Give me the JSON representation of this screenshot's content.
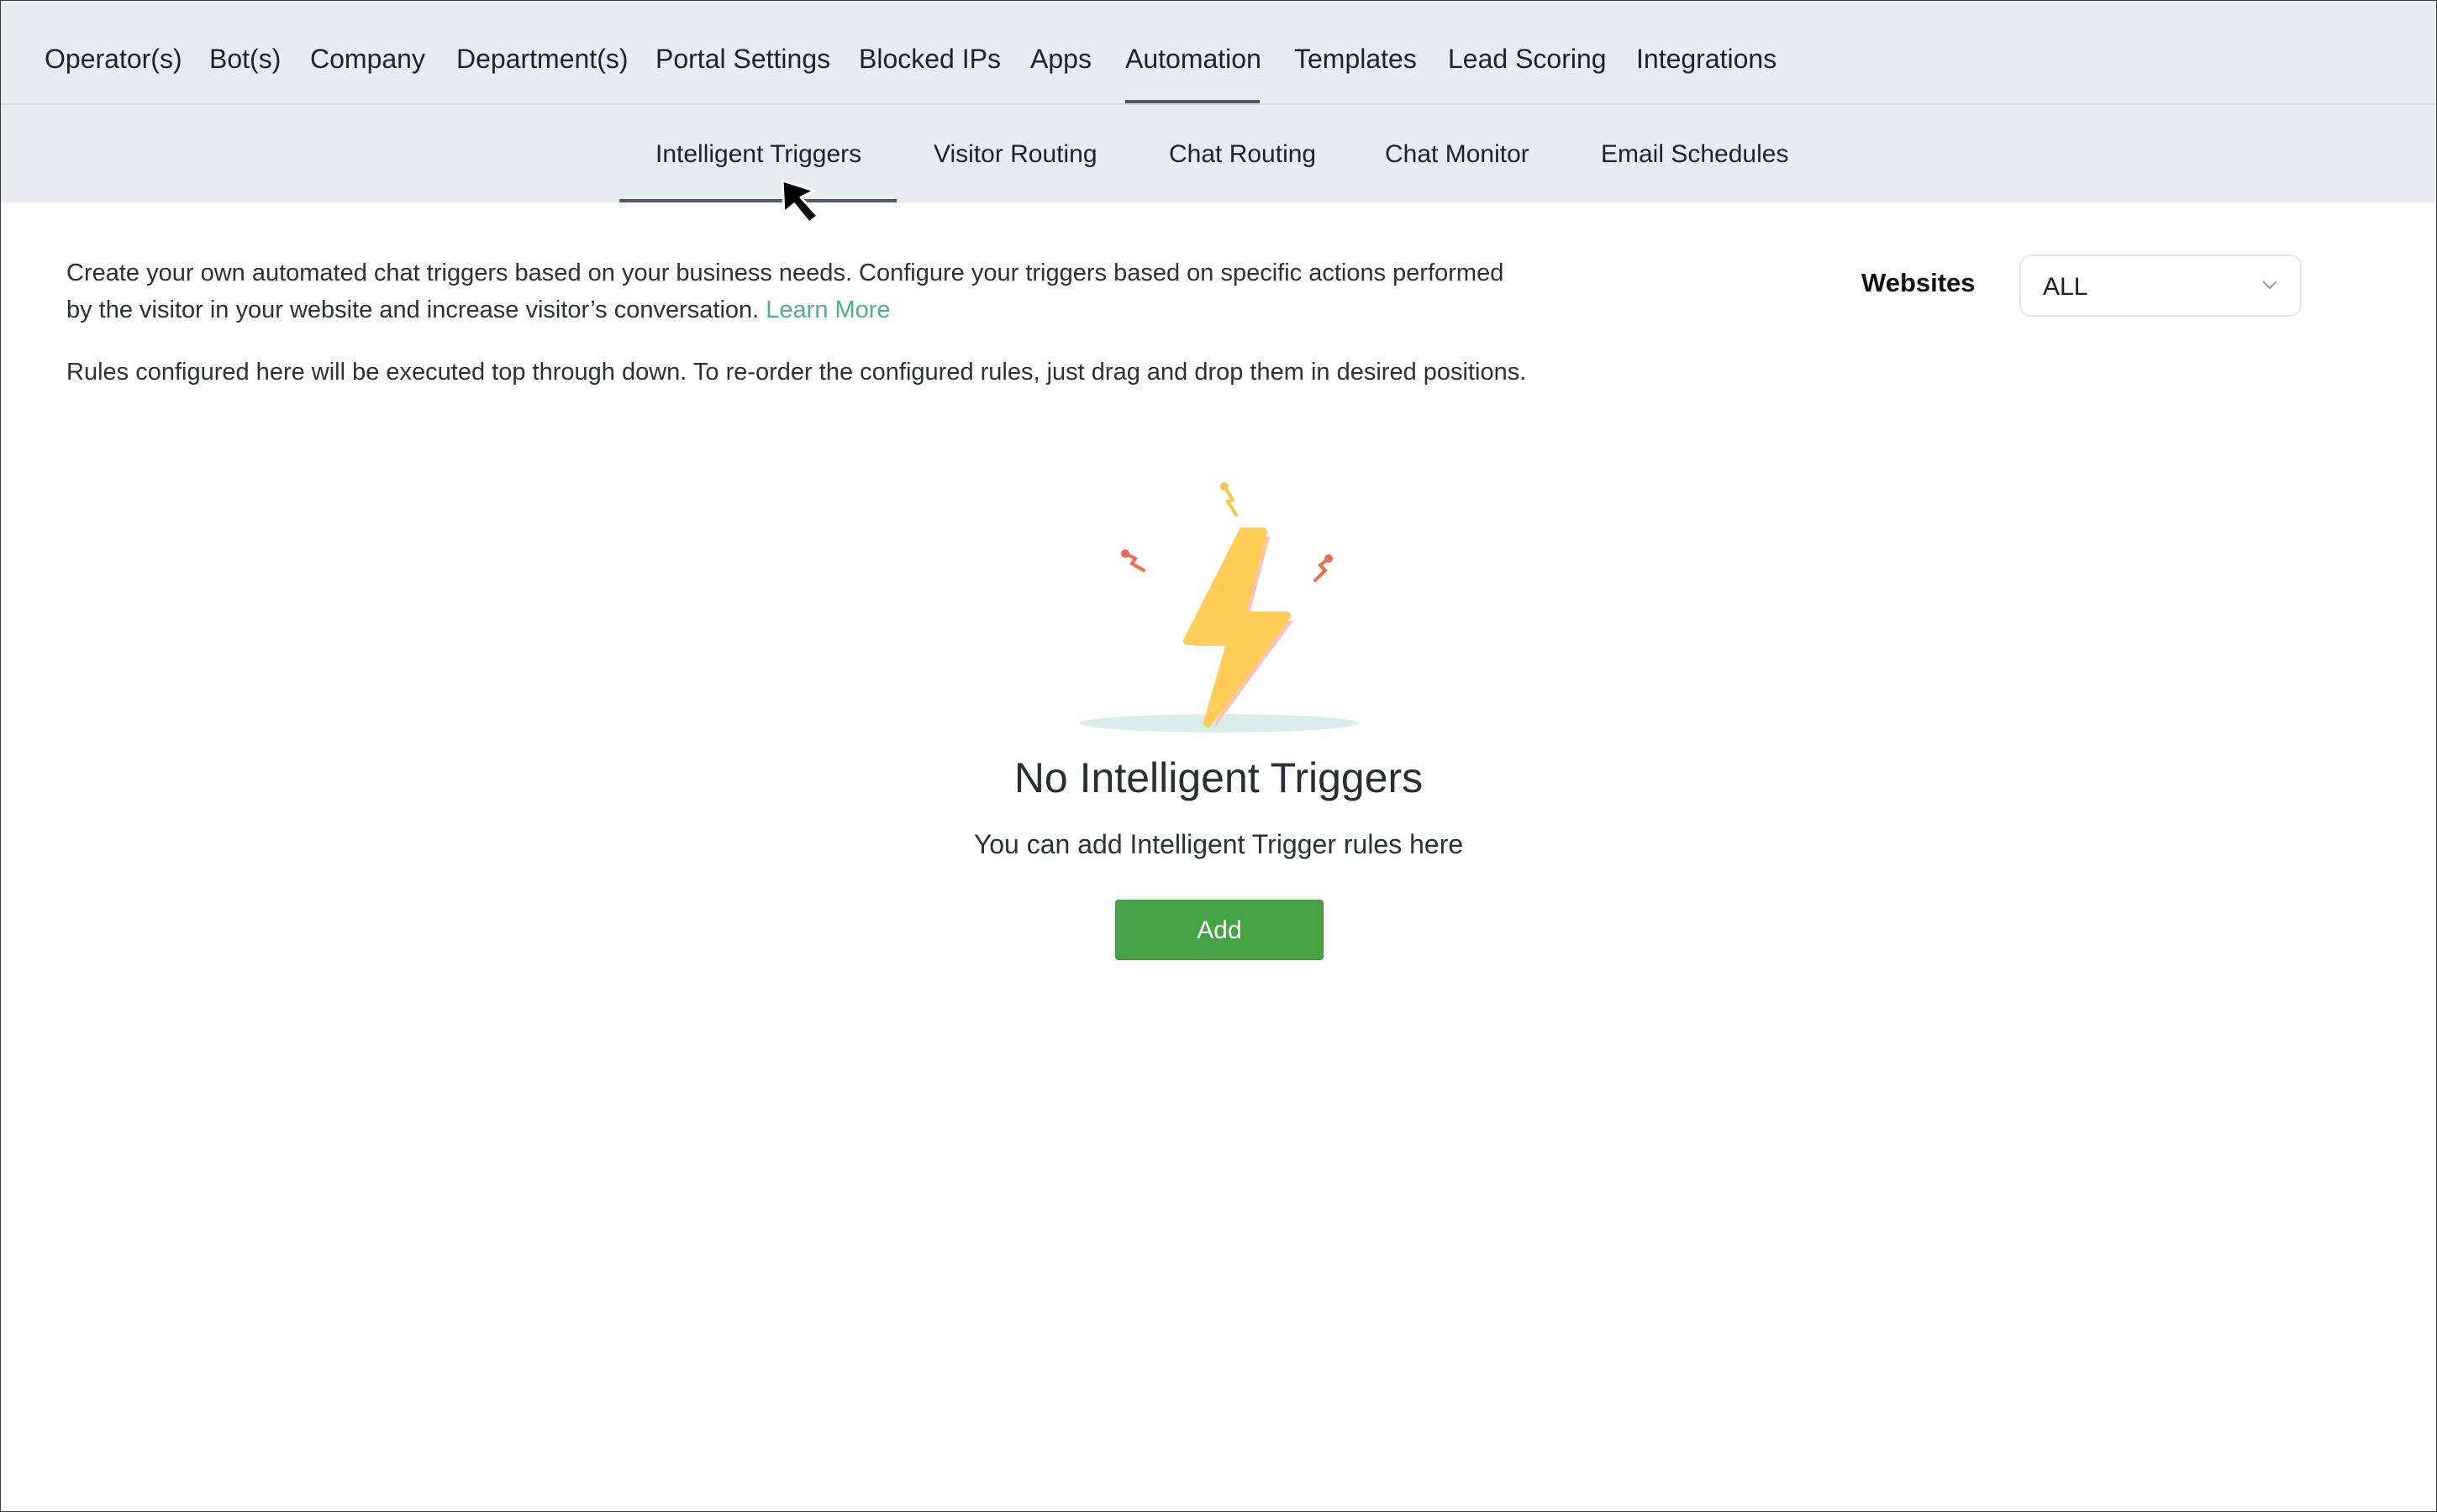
{
  "top_nav": {
    "items": [
      {
        "label": "Operator(s)"
      },
      {
        "label": "Bot(s)"
      },
      {
        "label": "Company"
      },
      {
        "label": "Department(s)"
      },
      {
        "label": "Portal Settings"
      },
      {
        "label": "Blocked IPs"
      },
      {
        "label": "Apps"
      },
      {
        "label": "Automation",
        "active": true
      },
      {
        "label": "Templates"
      },
      {
        "label": "Lead Scoring"
      },
      {
        "label": "Integrations"
      }
    ]
  },
  "sub_nav": {
    "items": [
      {
        "label": "Intelligent Triggers",
        "active": true
      },
      {
        "label": "Visitor Routing"
      },
      {
        "label": "Chat Routing"
      },
      {
        "label": "Chat Monitor"
      },
      {
        "label": "Email Schedules"
      }
    ]
  },
  "description": {
    "line1": "Create your own automated chat triggers based on your business needs. Configure your triggers based on specific actions performed",
    "line2": "by the visitor in your website and increase visitor’s conversation.",
    "learn_more": "Learn More",
    "rules_note": "Rules configured here will be executed top through down. To re-order the configured rules, just drag and drop them in desired positions."
  },
  "websites": {
    "label": "Websites",
    "selected": "ALL"
  },
  "empty_state": {
    "illustration": "lightning-bolt",
    "title": "No Intelligent Triggers",
    "subtitle": "You can add Intelligent Trigger rules here",
    "add_label": "Add"
  },
  "colors": {
    "nav_background": "#e8ecf0",
    "active_underline": "#4d5965",
    "link": "#4fae8c",
    "add_button": "#44a343",
    "bolt": "#ffcc55"
  }
}
